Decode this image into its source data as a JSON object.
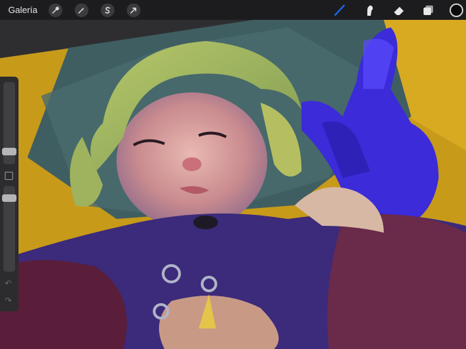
{
  "topbar": {
    "gallery_label": "Galería",
    "actions_icon": "wrench-icon",
    "adjustments_icon": "magic-wand-icon",
    "selection_icon": "selection-s-icon",
    "transform_icon": "arrow-cursor-icon",
    "brush_icon": "brush-icon",
    "smudge_icon": "smudge-finger-icon",
    "eraser_icon": "eraser-icon",
    "layers_icon": "layers-icon",
    "active_tool": "brush",
    "current_color": "#0d0a0a",
    "accent_color": "#1a6cff"
  },
  "sidebar": {
    "brush_size_level": 0.5,
    "opacity_level": 0.5,
    "modify_icon": "square-icon",
    "undo_icon": "undo-icon",
    "redo_icon": "redo-icon"
  },
  "artwork": {
    "description_alt": "",
    "subject": "illustration"
  }
}
